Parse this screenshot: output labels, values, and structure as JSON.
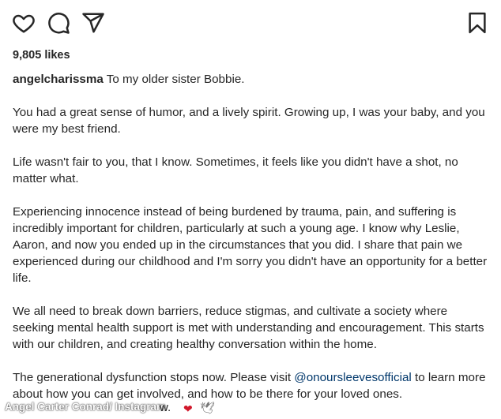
{
  "actions": {
    "like_icon": "heart-outline",
    "comment_icon": "speech-bubble",
    "share_icon": "paper-plane",
    "save_icon": "bookmark"
  },
  "likes": "9,805 likes",
  "caption": {
    "username": "angelcharissma",
    "first_line": "To my older sister Bobbie.",
    "paragraphs": [
      "You had a great sense of humor, and a lively spirit. Growing up, I was your baby, and you were my best friend.",
      "Life wasn't fair to you, that I know. Sometimes, it feels like you didn't have a shot, no matter what.",
      "Experiencing innocence instead of being burdened by trauma, pain, and suffering is incredibly important for children, particularly at such a young age. I know why Leslie, Aaron, and now you ended up in the circumstances that you did. I share that pain we experienced during our childhood and I'm sorry you didn't have an opportunity for a better life.",
      "We all need to break down barriers, reduce stigmas, and cultivate a society where seeking mental health support is met with understanding and encouragement. This starts with our children, and creating healthy conversation within the home."
    ],
    "last_before": "The generational dysfunction stops now. Please visit ",
    "mention": "@onoursleevesofficial",
    "last_after": " to learn more about how you can get involved, and how to be there for your loved ones."
  },
  "footer": {
    "watermark": "Angel Carter Conrad/ Instagram",
    "tail": "w.",
    "emoji1": "❤",
    "emoji2": "🕊"
  }
}
